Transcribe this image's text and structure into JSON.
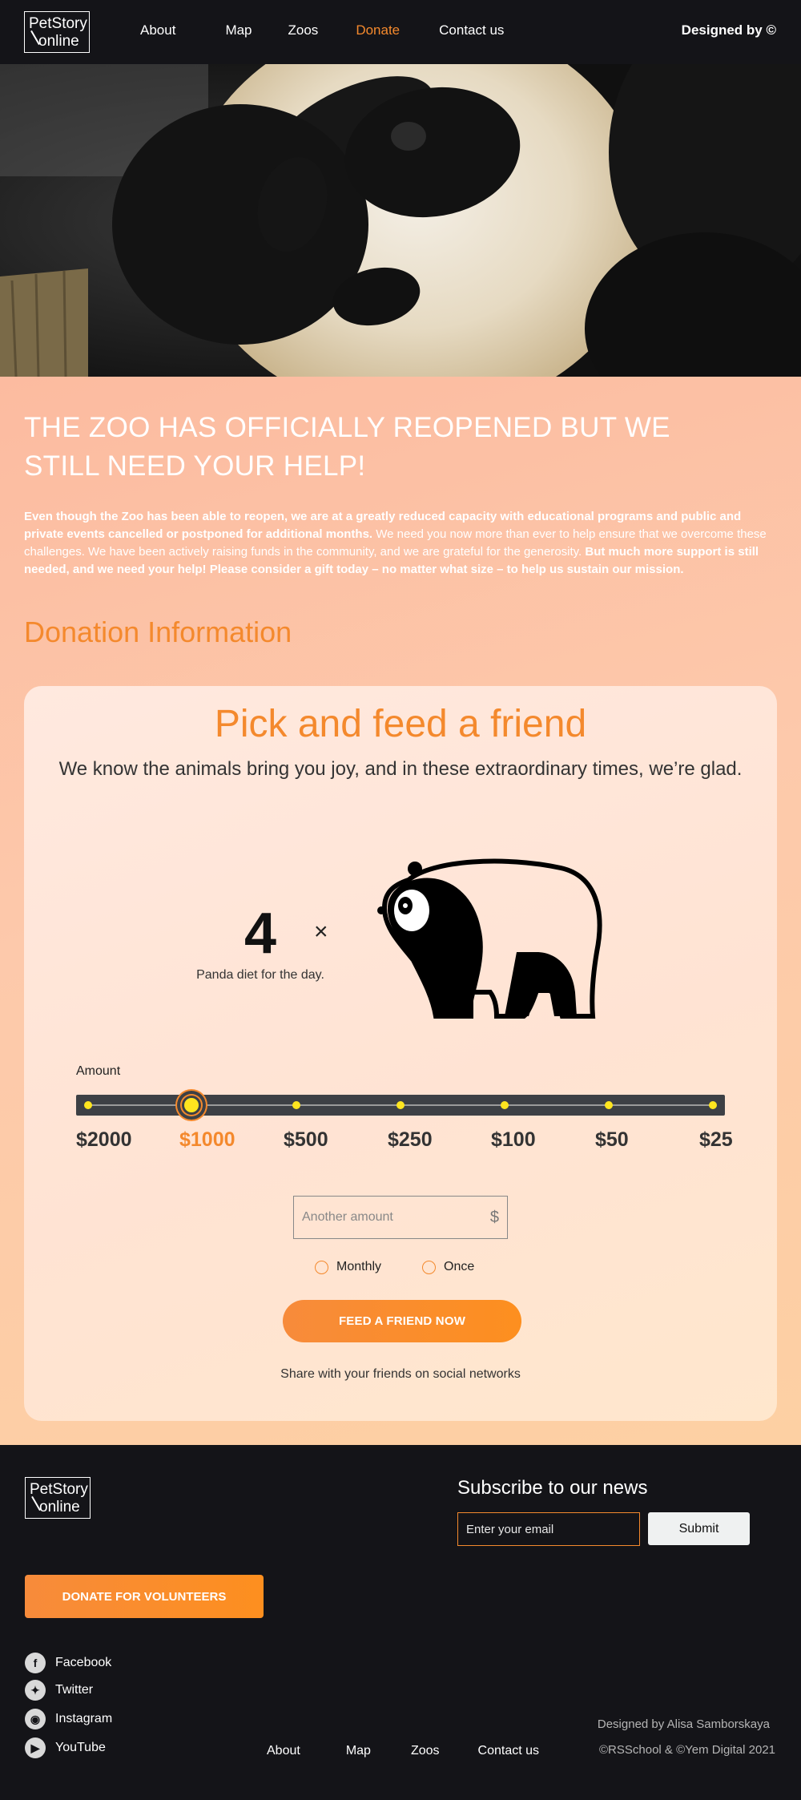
{
  "header": {
    "logo_line1": "PetStory",
    "logo_line2": "online",
    "nav": [
      "About",
      "Map",
      "Zoos",
      "Donate",
      "Contact us"
    ],
    "active_nav": "Donate",
    "designed_by": "Designed by ©"
  },
  "hero": {
    "image": "panda-face-photo"
  },
  "main": {
    "headline": "THE ZOO HAS OFFICIALLY REOPENED BUT WE STILL NEED YOUR HELP!",
    "intro_bold": "Even though the Zoo has been able to reopen, we are at a greatly reduced capacity with educational programs and public and private events cancelled or postponed for additional months.",
    "intro_regular": "We need you now more than ever to help ensure that we overcome these challenges. We have been actively raising funds in the community, and we are grateful for the generosity.",
    "intro_bold2": "But much more support is still needed, and we need your help! Please consider a gift today – no matter what size – to help us sustain our mission.",
    "section_title": "Donation Information"
  },
  "card": {
    "title": "Pick and feed a friend",
    "subtitle": "We know the animals bring you joy, and in these extraordinary times, we’re glad.",
    "count": "4",
    "count_caption": "Panda diet for the day.",
    "times_symbol": "×",
    "amount_label": "Amount",
    "amounts": [
      "$2000",
      "$1000",
      "$500",
      "$250",
      "$100",
      "$50",
      "$25"
    ],
    "selected_amount": "$1000",
    "other_placeholder": "Another amount",
    "currency": "$",
    "radio_monthly": "Monthly",
    "radio_once": "Once",
    "feed_button": "FEED A FRIEND NOW",
    "share_text": "Share with your friends on social networks"
  },
  "footer": {
    "logo_line1": "PetStory",
    "logo_line2": "online",
    "subscribe_title": "Subscribe to our news",
    "email_placeholder": "Enter your email",
    "submit_label": "Submit",
    "volunteer_button": "DONATE FOR VOLUNTEERS",
    "socials": [
      {
        "label": "Facebook",
        "icon": "facebook-icon"
      },
      {
        "label": "Twitter",
        "icon": "twitter-icon"
      },
      {
        "label": "Instagram",
        "icon": "instagram-icon"
      },
      {
        "label": "YouTube",
        "icon": "youtube-icon"
      }
    ],
    "nav": [
      "About",
      "Map",
      "Zoos",
      "Contact us"
    ],
    "credit_designer": "Designed by Alisa Samborskaya",
    "credit_copyright": "©RSSchool & ©Yem Digital 2021"
  },
  "colors": {
    "accent": "#f4892d",
    "dark": "#141418",
    "slider_dot": "#ffe51f"
  }
}
